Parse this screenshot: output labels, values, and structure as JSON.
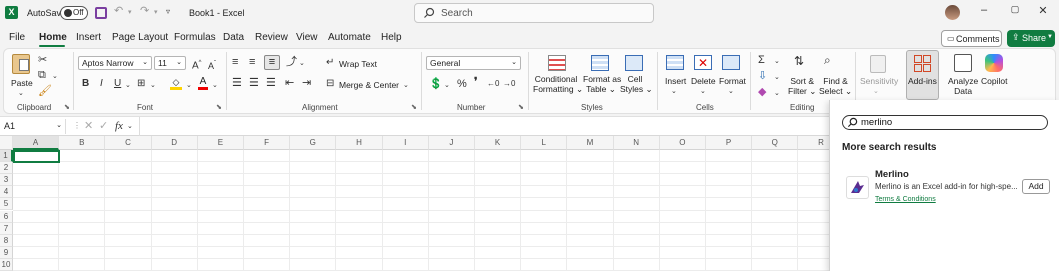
{
  "titlebar": {
    "autosave_label": "AutoSave",
    "autosave_state": "Off",
    "doc_title": "Book1  -  Excel",
    "search_placeholder": "Search"
  },
  "menu": [
    "File",
    "Home",
    "Insert",
    "Page Layout",
    "Formulas",
    "Data",
    "Review",
    "View",
    "Automate",
    "Help"
  ],
  "header_buttons": {
    "comments": "Comments",
    "share": "Share"
  },
  "ribbon": {
    "clipboard": {
      "paste": "Paste",
      "label": "Clipboard"
    },
    "font": {
      "name": "Aptos Narrow",
      "size": "11",
      "label": "Font"
    },
    "alignment": {
      "wrap": "Wrap Text",
      "merge": "Merge & Center",
      "label": "Alignment"
    },
    "number": {
      "format": "General",
      "label": "Number"
    },
    "styles": {
      "cond1": "Conditional",
      "cond2": "Formatting",
      "fmt1": "Format as",
      "fmt2": "Table",
      "cell1": "Cell",
      "cell2": "Styles",
      "label": "Styles"
    },
    "cells": {
      "insert": "Insert",
      "delete": "Delete",
      "format": "Format",
      "label": "Cells"
    },
    "editing": {
      "sort1": "Sort &",
      "sort2": "Filter",
      "find1": "Find &",
      "find2": "Select",
      "label": "Editing"
    },
    "sensitivity": "Sensitivity",
    "addins": "Add-ins",
    "analyze1": "Analyze",
    "analyze2": "Data",
    "copilot": "Copilot"
  },
  "formula_bar": {
    "name_box": "A1",
    "fx": "fx"
  },
  "grid": {
    "columns": [
      "A",
      "B",
      "C",
      "D",
      "E",
      "F",
      "G",
      "H",
      "I",
      "J",
      "K",
      "L",
      "M",
      "N",
      "O",
      "P",
      "Q",
      "R"
    ],
    "rows": [
      "1",
      "2",
      "3",
      "4",
      "5",
      "6",
      "7",
      "8",
      "9",
      "10"
    ]
  },
  "panel": {
    "search_value": "merlino",
    "results_title": "More search results",
    "addin_name": "Merlino",
    "addin_desc": "Merlino is an Excel add-in for high-spe...",
    "addin_link": "Terms & Conditions",
    "add_button": "Add"
  },
  "colors": {
    "accent": "#107c41",
    "selection": "#107c41"
  }
}
